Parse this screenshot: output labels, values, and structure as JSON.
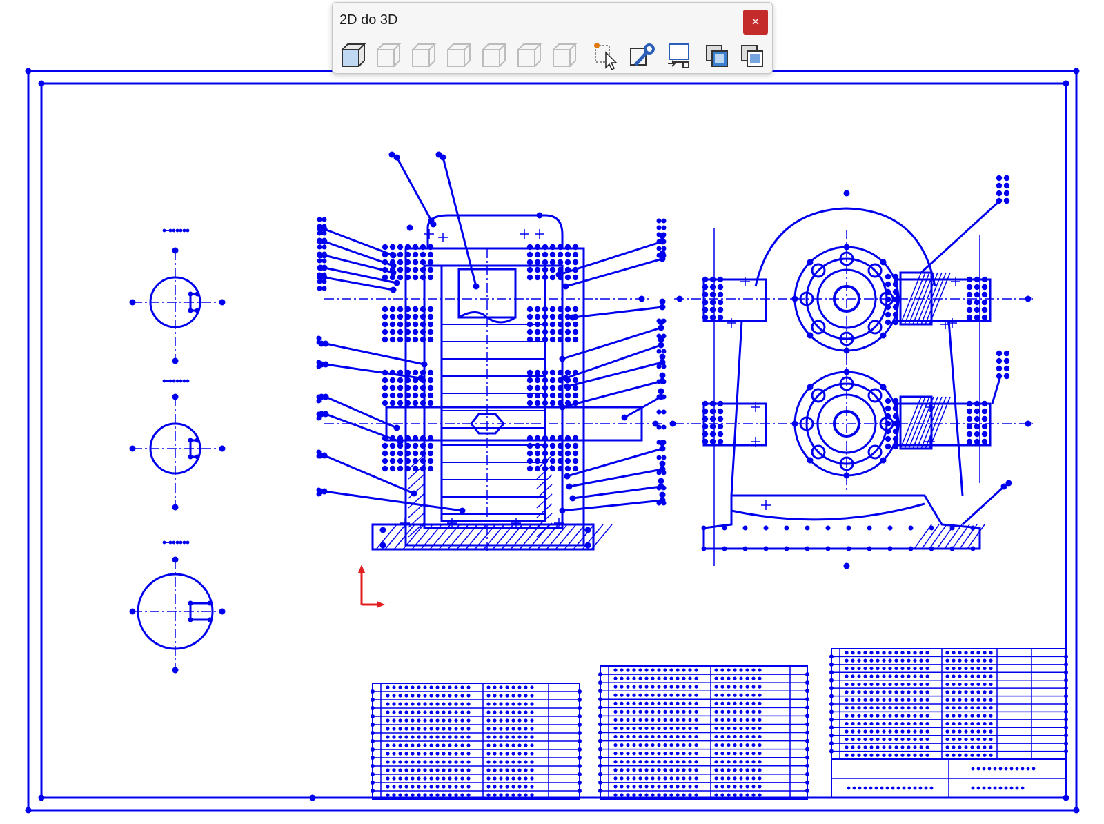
{
  "toolbar": {
    "title": "2D do 3D",
    "close_glyph": "×",
    "buttons": [
      {
        "name": "front-view-button",
        "icon": "cube-front-icon",
        "enabled": true
      },
      {
        "name": "top-view-button",
        "icon": "cube-top-icon",
        "enabled": false
      },
      {
        "name": "bottom-view-button",
        "icon": "cube-bottom-icon",
        "enabled": false
      },
      {
        "name": "left-view-button",
        "icon": "cube-left-icon",
        "enabled": false
      },
      {
        "name": "right-view-button",
        "icon": "cube-right-icon",
        "enabled": false
      },
      {
        "name": "back-view-button",
        "icon": "cube-back-icon",
        "enabled": false
      },
      {
        "name": "auxiliary-view-button",
        "icon": "cube-auxiliary-icon",
        "enabled": false
      },
      {
        "name": "select-sketch-entities-button",
        "icon": "select-cursor-icon",
        "enabled": true
      },
      {
        "name": "repair-sketch-button",
        "icon": "wrench-icon",
        "enabled": true
      },
      {
        "name": "align-sketch-button",
        "icon": "align-sketch-icon",
        "enabled": true
      },
      {
        "name": "extrude-button",
        "icon": "extrude-icon",
        "enabled": true
      },
      {
        "name": "cut-button",
        "icon": "cut-icon",
        "enabled": true
      }
    ]
  },
  "colors": {
    "sketch": "#0000ee",
    "axis_x": "#e02020",
    "axis_y": "#e02020",
    "close_bg": "#c42b2b"
  }
}
